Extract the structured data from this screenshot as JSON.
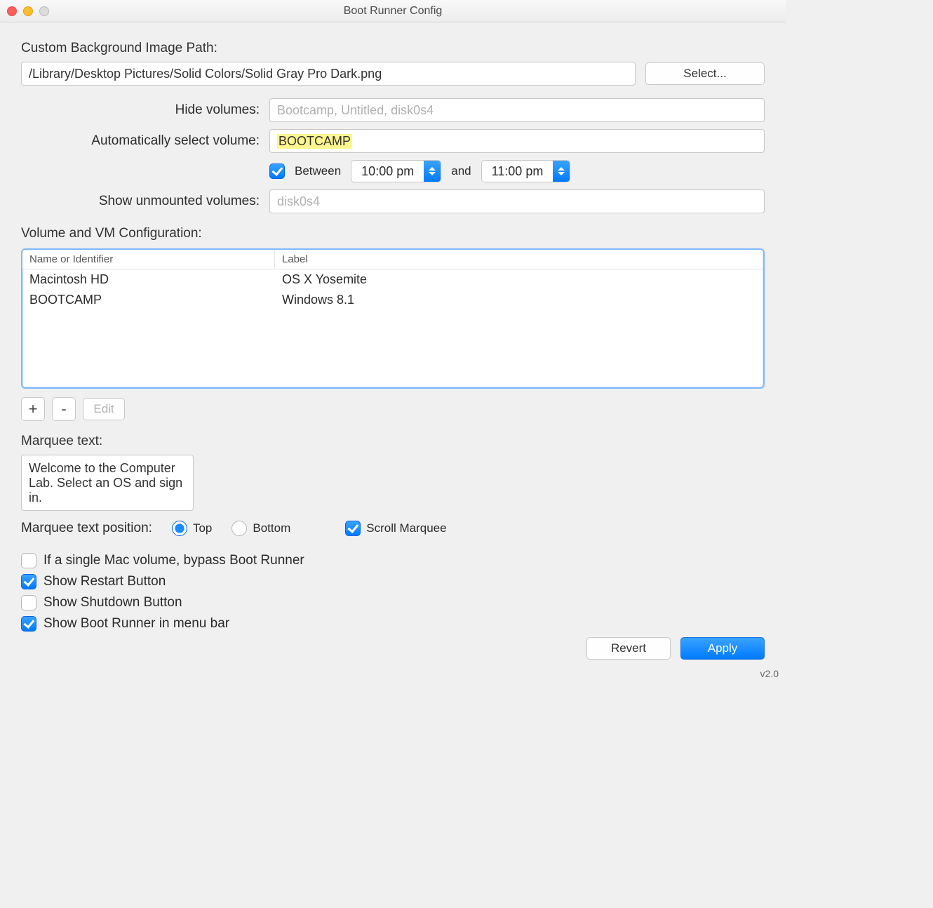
{
  "window": {
    "title": "Boot Runner Config"
  },
  "bg": {
    "label": "Custom Background Image Path:",
    "path": "/Library/Desktop Pictures/Solid Colors/Solid Gray Pro Dark.png",
    "select_btn": "Select..."
  },
  "hide": {
    "label": "Hide volumes:",
    "placeholder": "Bootcamp, Untitled, disk0s4"
  },
  "auto": {
    "label": "Automatically select volume:",
    "value": "BOOTCAMP"
  },
  "between": {
    "checked": true,
    "label": "Between",
    "start": "10:00 pm",
    "and": "and",
    "end": "11:00 pm"
  },
  "show": {
    "label": "Show unmounted volumes:",
    "placeholder": "disk0s4"
  },
  "vmsection": {
    "label": "Volume and VM Configuration:"
  },
  "table": {
    "headers": {
      "name": "Name or Identifier",
      "label": "Label"
    },
    "rows": [
      {
        "name": "Macintosh HD",
        "label": "OS X Yosemite"
      },
      {
        "name": "BOOTCAMP",
        "label": "Windows 8.1"
      }
    ],
    "add_btn": "+",
    "remove_btn": "-",
    "edit_btn": "Edit"
  },
  "marquee": {
    "label": "Marquee text:",
    "value": "Welcome to the Computer Lab. Select an OS and sign in.",
    "position_label": "Marquee text position:",
    "top": "Top",
    "bottom": "Bottom",
    "scroll": "Scroll Marquee"
  },
  "checks": {
    "bypass": {
      "label": "If a single Mac volume, bypass Boot Runner",
      "checked": false
    },
    "restart": {
      "label": "Show Restart Button",
      "checked": true
    },
    "shutdown": {
      "label": "Show Shutdown Button",
      "checked": false
    },
    "menubar": {
      "label": "Show Boot Runner in menu bar",
      "checked": true
    }
  },
  "footer": {
    "revert": "Revert",
    "apply": "Apply"
  },
  "version": "v2.0"
}
